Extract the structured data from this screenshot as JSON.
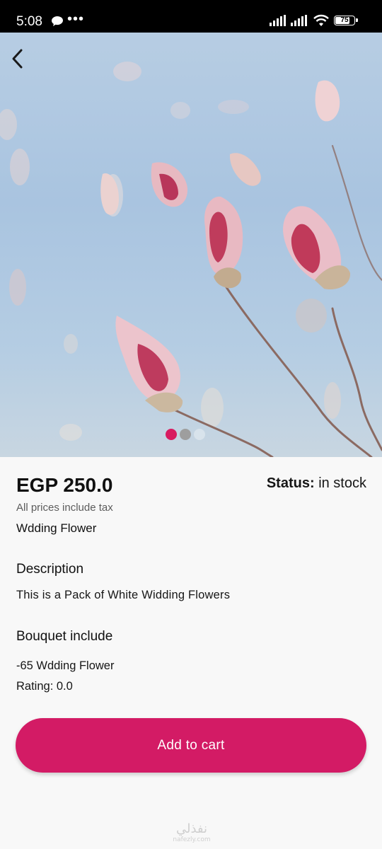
{
  "status_bar": {
    "time": "5:08",
    "dots": "•••",
    "battery_level": "75"
  },
  "product": {
    "image_slide_count": 3,
    "active_slide": 1,
    "price": "EGP 250.0",
    "status_label": "Status:",
    "status_value": "in stock",
    "tax_note": "All prices include tax",
    "name": "Wdding Flower",
    "description_heading": "Description",
    "description_text": "This is a Pack of White Widding Flowers",
    "bouquet_heading": "Bouquet include",
    "bouquet_item": "-65 Wdding Flower",
    "rating": "Rating: 0.0"
  },
  "actions": {
    "add_to_cart_label": "Add to cart"
  },
  "watermark": {
    "arabic": "نفذلي",
    "latin": "nafezly.com"
  },
  "icons": {
    "back": "back-arrow-icon",
    "chat": "chat-bubble-icon",
    "signal": "signal-icon",
    "wifi": "wifi-icon",
    "battery": "battery-icon"
  },
  "colors": {
    "accent": "#d31b65",
    "dot_active": "#d81b60",
    "dot_inactive": "#9e9e9e",
    "background": "#f8f8f8"
  }
}
